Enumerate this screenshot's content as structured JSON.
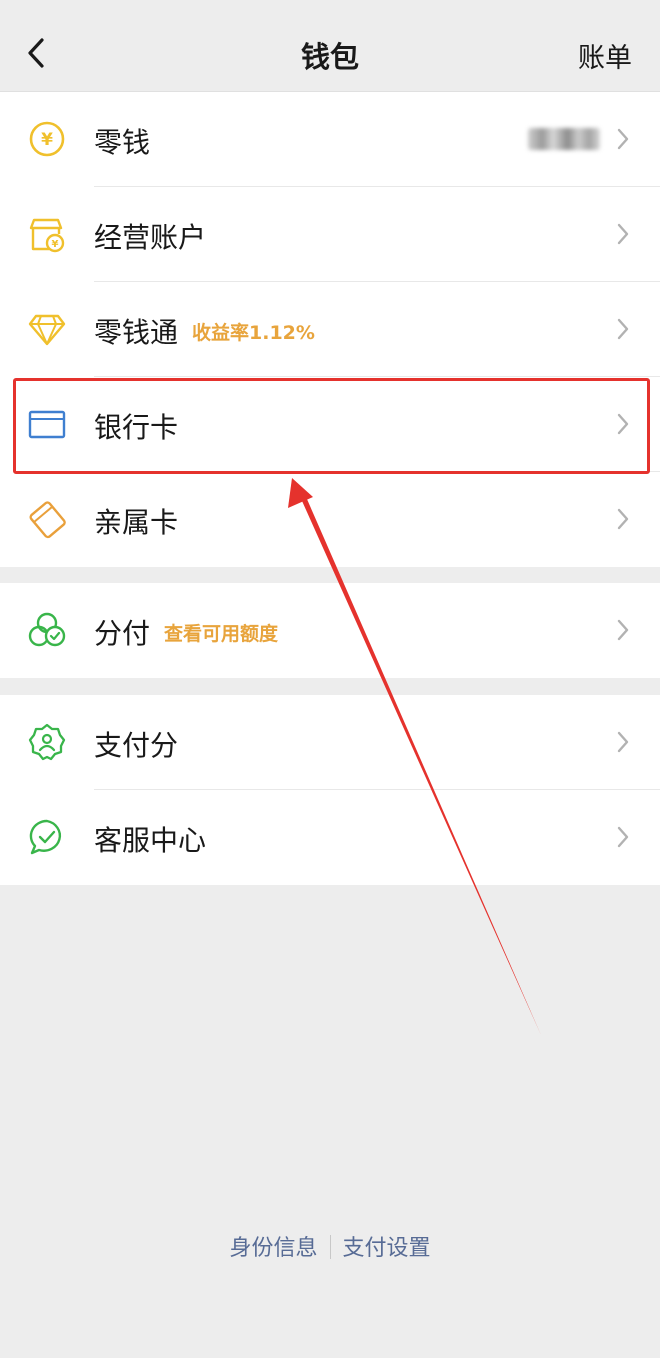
{
  "header": {
    "title": "钱包",
    "right_link": "账单"
  },
  "groups": [
    {
      "items": [
        {
          "label": "零钱",
          "icon": "yen-coin-icon",
          "blurred_value": true
        },
        {
          "label": "经营账户",
          "icon": "shop-account-icon"
        },
        {
          "label": "零钱通",
          "icon": "diamond-icon",
          "tag": "收益率1.12%"
        },
        {
          "label": "银行卡",
          "icon": "bank-card-icon"
        },
        {
          "label": "亲属卡",
          "icon": "family-card-icon"
        }
      ]
    },
    {
      "items": [
        {
          "label": "分付",
          "icon": "fenfu-circles-icon",
          "tag": "查看可用额度"
        }
      ]
    },
    {
      "items": [
        {
          "label": "支付分",
          "icon": "pay-score-badge-icon"
        },
        {
          "label": "客服中心",
          "icon": "customer-service-icon"
        }
      ]
    }
  ],
  "footer": {
    "links": [
      "身份信息",
      "支付设置"
    ]
  },
  "colors": {
    "background": "#ededed",
    "tag": "#e8a43c",
    "link": "#576b95",
    "annotation_red": "#e5322d",
    "icon_yellow": "#f0c02c",
    "icon_blue": "#3f7fd0",
    "icon_orange": "#e9a03b",
    "icon_green": "#39b54a"
  }
}
